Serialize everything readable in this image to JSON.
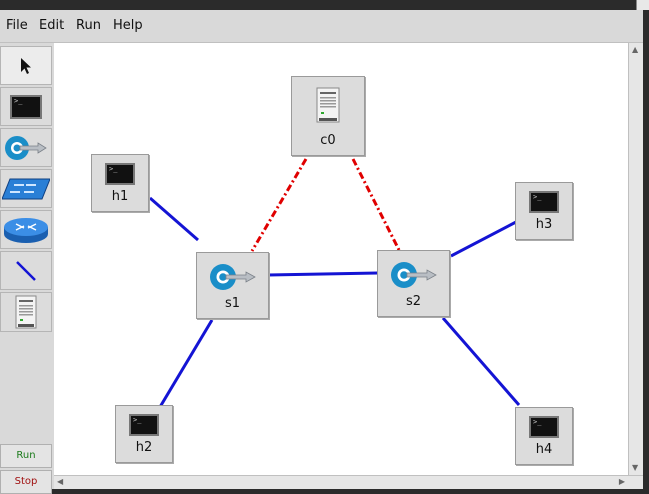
{
  "menubar": {
    "items": [
      {
        "label": "File"
      },
      {
        "label": "Edit"
      },
      {
        "label": "Run"
      },
      {
        "label": "Help"
      }
    ]
  },
  "toolbar": {
    "tools": [
      {
        "icon": "pointer-icon"
      },
      {
        "icon": "host-icon"
      },
      {
        "icon": "switch-icon"
      },
      {
        "icon": "legacy-switch-icon"
      },
      {
        "icon": "router-icon"
      },
      {
        "icon": "link-icon"
      },
      {
        "icon": "controller-icon"
      }
    ],
    "run_label": "Run",
    "stop_label": "Stop",
    "run_color": "#1a7a1a",
    "stop_color": "#a01010"
  },
  "topology": {
    "nodes": [
      {
        "id": "c0",
        "label": "c0",
        "type": "controller"
      },
      {
        "id": "h1",
        "label": "h1",
        "type": "host"
      },
      {
        "id": "h3",
        "label": "h3",
        "type": "host"
      },
      {
        "id": "s1",
        "label": "s1",
        "type": "switch"
      },
      {
        "id": "s2",
        "label": "s2",
        "type": "switch"
      },
      {
        "id": "h2",
        "label": "h2",
        "type": "host"
      },
      {
        "id": "h4",
        "label": "h4",
        "type": "host"
      }
    ],
    "links": [
      {
        "from": "h1",
        "to": "s1",
        "style": "data"
      },
      {
        "from": "s1",
        "to": "s2",
        "style": "data"
      },
      {
        "from": "s2",
        "to": "h3",
        "style": "data"
      },
      {
        "from": "s1",
        "to": "h2",
        "style": "data"
      },
      {
        "from": "s2",
        "to": "h4",
        "style": "data"
      },
      {
        "from": "c0",
        "to": "s1",
        "style": "control"
      },
      {
        "from": "c0",
        "to": "s2",
        "style": "control"
      }
    ],
    "data_link_color": "#1414d4",
    "control_link_color": "#e00000"
  }
}
